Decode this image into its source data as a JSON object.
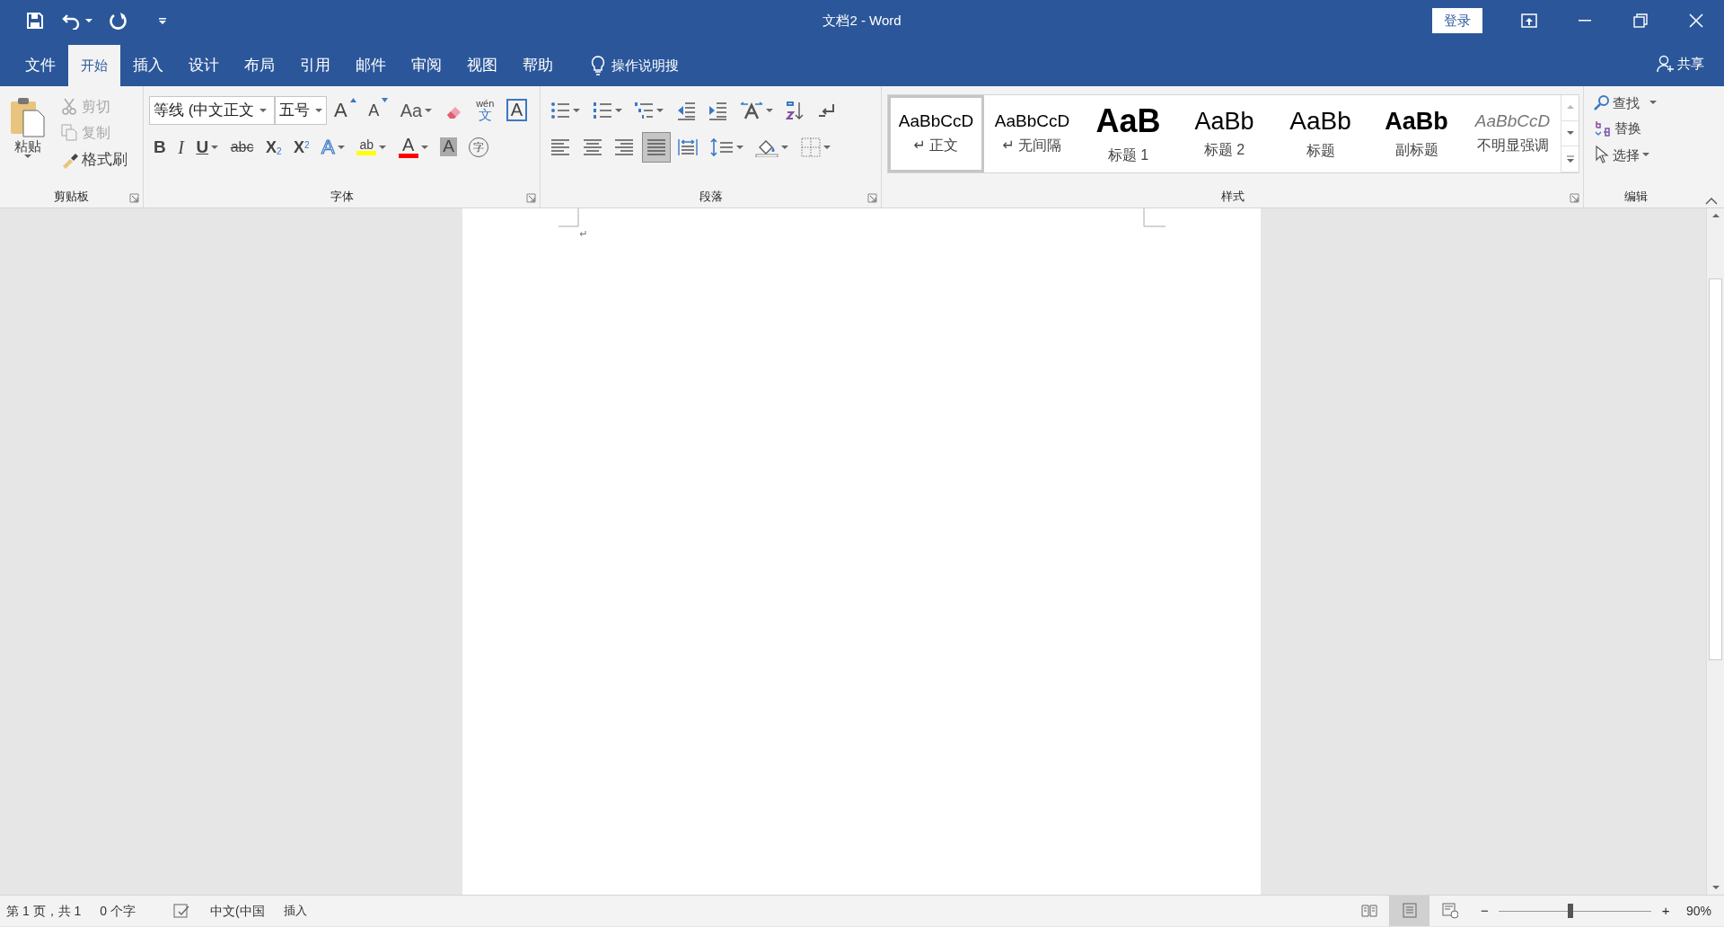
{
  "window": {
    "title": "文档2 - Word",
    "sign_in": "登录"
  },
  "tabs": [
    {
      "label": "文件",
      "selected": false
    },
    {
      "label": "开始",
      "selected": true
    },
    {
      "label": "插入",
      "selected": false
    },
    {
      "label": "设计",
      "selected": false
    },
    {
      "label": "布局",
      "selected": false
    },
    {
      "label": "引用",
      "selected": false
    },
    {
      "label": "邮件",
      "selected": false
    },
    {
      "label": "审阅",
      "selected": false
    },
    {
      "label": "视图",
      "selected": false
    },
    {
      "label": "帮助",
      "selected": false
    }
  ],
  "tell_me": "操作说明搜",
  "share": "共享",
  "clipboard": {
    "paste": "粘贴",
    "cut": {
      "label": "剪切",
      "disabled": true
    },
    "copy": {
      "label": "复制",
      "disabled": true
    },
    "format_painter": {
      "label": "格式刷",
      "disabled": false
    },
    "group_label": "剪贴板"
  },
  "font": {
    "name": "等线 (中文正文",
    "size": "五号",
    "group_label": "字体",
    "row1": [
      {
        "kind": "grow",
        "glyph": "A",
        "dropdown": false
      },
      {
        "kind": "shrink",
        "glyph": "A",
        "dropdown": false
      },
      {
        "kind": "case",
        "glyph": "Aa",
        "dropdown": true
      },
      {
        "kind": "clear",
        "dropdown": false
      },
      {
        "kind": "phonetic",
        "glyph": "wén",
        "sub": "文",
        "dropdown": false
      },
      {
        "kind": "border",
        "glyph": "A",
        "dropdown": false
      }
    ],
    "row2": [
      {
        "kind": "bold",
        "glyph": "B",
        "dropdown": false
      },
      {
        "kind": "italic",
        "glyph": "I",
        "dropdown": false
      },
      {
        "kind": "underline",
        "glyph": "U",
        "dropdown": true
      },
      {
        "kind": "strike",
        "glyph": "abc",
        "dropdown": false
      },
      {
        "kind": "subscript",
        "glyph": "X",
        "sub": "2",
        "dropdown": false
      },
      {
        "kind": "superscript",
        "glyph": "X",
        "sub": "2",
        "dropdown": false
      },
      {
        "kind": "effects",
        "glyph": "A",
        "dropdown": true
      },
      {
        "kind": "highlight",
        "glyph": "ab",
        "color": "#ffff00",
        "dropdown": true
      },
      {
        "kind": "color",
        "glyph": "A",
        "color": "#ff0000",
        "dropdown": true
      },
      {
        "kind": "shading",
        "glyph": "A",
        "dropdown": false
      },
      {
        "kind": "enclose",
        "glyph": "字",
        "dropdown": false
      }
    ]
  },
  "paragraph": {
    "group_label": "段落",
    "alignments": [
      {
        "selected": false
      },
      {
        "selected": false
      },
      {
        "selected": false
      },
      {
        "selected": true
      },
      {
        "selected": false
      }
    ]
  },
  "styles": {
    "group_label": "样式",
    "items": [
      {
        "preview": "AaBbCcD",
        "name": "正文",
        "mark": "↵",
        "kind": "plain",
        "selected": true
      },
      {
        "preview": "AaBbCcD",
        "name": "无间隔",
        "mark": "↵",
        "kind": "plain",
        "selected": false
      },
      {
        "preview": "AaB",
        "name": "标题 1",
        "kind": "heading1",
        "selected": false
      },
      {
        "preview": "AaBb",
        "name": "标题 2",
        "kind": "heading2",
        "selected": false
      },
      {
        "preview": "AaBb",
        "name": "标题",
        "kind": "title",
        "selected": false
      },
      {
        "preview": "AaBb",
        "name": "副标题",
        "kind": "subtitle",
        "selected": false
      },
      {
        "preview": "AaBbCcD",
        "name": "不明显强调",
        "kind": "emphasis",
        "selected": false
      }
    ]
  },
  "editing": {
    "group_label": "编辑",
    "find": "查找",
    "replace": "替换",
    "select": "选择"
  },
  "document": {
    "paragraph_mark": "↵"
  },
  "status_bar": {
    "page": "第 1 页，共 1",
    "words": "0 个字",
    "language": "中文(中国",
    "mode": "插入",
    "views": [
      {
        "selected": false
      },
      {
        "selected": true
      },
      {
        "selected": false
      }
    ],
    "zoom_out": "−",
    "zoom_in": "+",
    "zoom": {
      "level": 0.47
    },
    "zoom_text": "90%"
  }
}
